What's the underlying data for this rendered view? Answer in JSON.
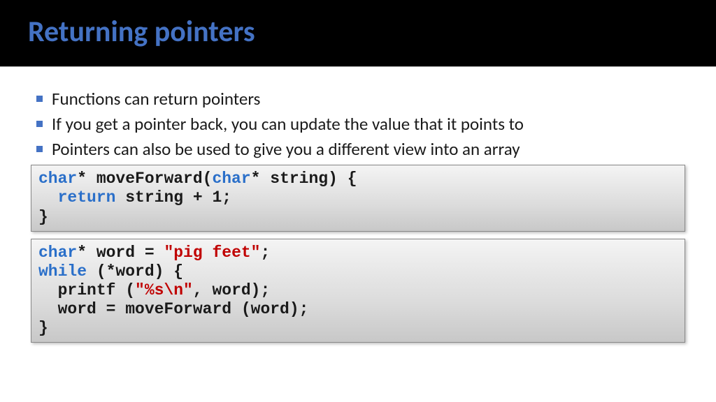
{
  "header": {
    "title": "Returning pointers"
  },
  "bullets": [
    "Functions can return pointers",
    "If you get a pointer back, you can update the value that it points to",
    "Pointers can also be used to give you a different view into an array"
  ],
  "code1": {
    "l1a": "char",
    "l1b": "* moveForward(",
    "l1c": "char",
    "l1d": "* string) {",
    "l2a": "  ",
    "l2b": "return",
    "l2c": " string + 1;",
    "l3": "}"
  },
  "code2": {
    "l1a": "char",
    "l1b": "* word = ",
    "l1c": "\"pig feet\"",
    "l1d": ";",
    "l2a": "while",
    "l2b": " (*word) {",
    "l3a": "  printf (",
    "l3b": "\"%s\\n\"",
    "l3c": ", word);",
    "l4": "  word = moveForward (word);",
    "l5": "}"
  }
}
